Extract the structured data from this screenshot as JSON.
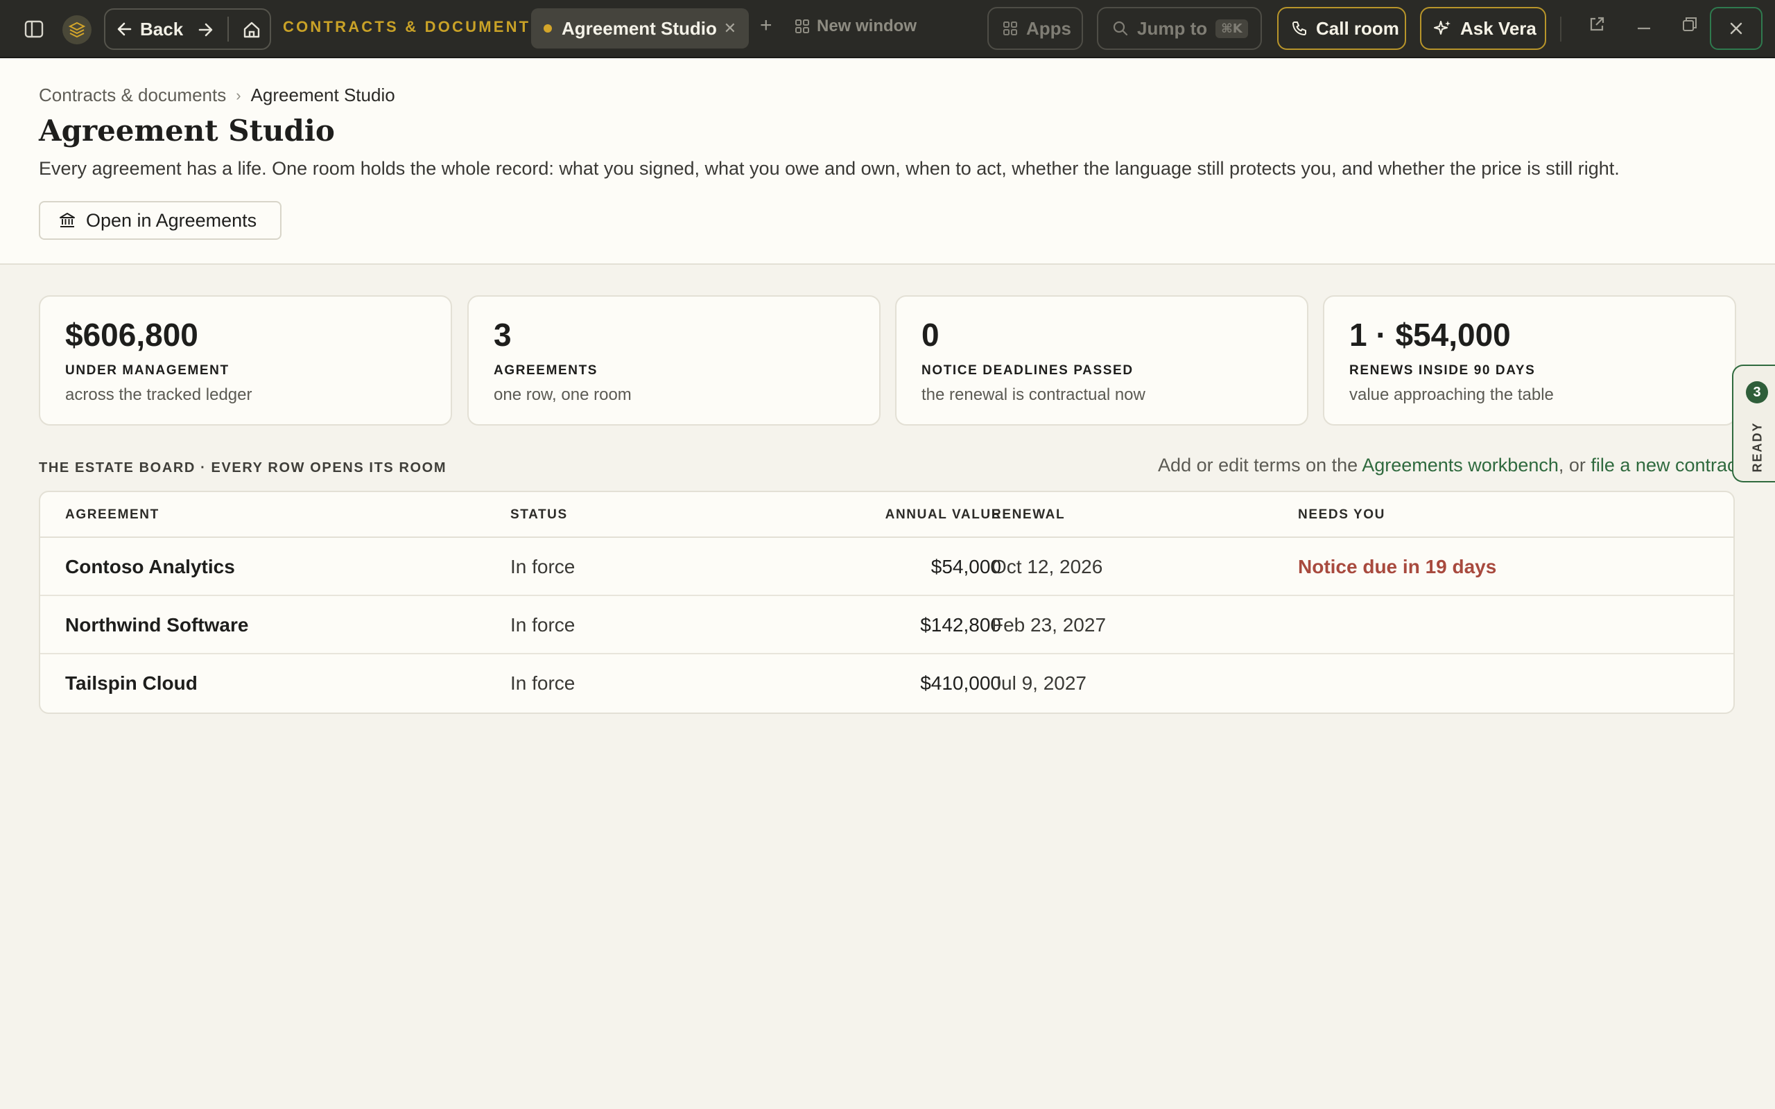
{
  "topbar": {
    "back_label": "Back",
    "app_title": "CONTRACTS & DOCUMENTS",
    "tab_label": "Agreement Studio",
    "new_window_label": "New window",
    "apps_label": "Apps",
    "jump_label": "Jump to",
    "jump_shortcut": "⌘K",
    "call_label": "Call room",
    "ask_label": "Ask Vera",
    "accent_color": "#c9a227"
  },
  "header": {
    "breadcrumb_parent": "Contracts & documents",
    "breadcrumb_current": "Agreement Studio",
    "title": "Agreement Studio",
    "description": "Every agreement has a life. One room holds the whole record: what you signed, what you owe and own, when to act, whether the language still protects you, and whether the price is still right.",
    "open_button_label": "Open in Agreements"
  },
  "stats": [
    {
      "value": "$606,800",
      "label": "UNDER MANAGEMENT",
      "sub": "across the tracked ledger"
    },
    {
      "value": "3",
      "label": "AGREEMENTS",
      "sub": "one row, one room"
    },
    {
      "value": "0",
      "label": "NOTICE DEADLINES PASSED",
      "sub": "the renewal is contractual now"
    },
    {
      "value": "1 · $54,000",
      "label": "RENEWS INSIDE 90 DAYS",
      "sub": "value approaching the table"
    }
  ],
  "board": {
    "label": "THE ESTATE BOARD · EVERY ROW OPENS ITS ROOM",
    "note_prefix": "Add or edit terms on the ",
    "note_link1": "Agreements workbench",
    "note_mid": ", or ",
    "note_link2": "file a new contract",
    "columns": [
      "AGREEMENT",
      "STATUS",
      "ANNUAL VALUE",
      "RENEWAL",
      "NEEDS YOU"
    ],
    "rows": [
      {
        "agreement": "Contoso Analytics",
        "status": "In force",
        "value": "$54,000",
        "renewal": "Oct 12, 2026",
        "needs": "Notice due in 19 days"
      },
      {
        "agreement": "Northwind Software",
        "status": "In force",
        "value": "$142,800",
        "renewal": "Feb 23, 2027",
        "needs": ""
      },
      {
        "agreement": "Tailspin Cloud",
        "status": "In force",
        "value": "$410,000",
        "renewal": "Jul 9, 2027",
        "needs": ""
      }
    ]
  },
  "side_panel": {
    "count": "3",
    "label": "READY"
  },
  "colors": {
    "warning": "#a84a3e",
    "link": "#2f6a3e",
    "background": "#f5f3ec"
  }
}
